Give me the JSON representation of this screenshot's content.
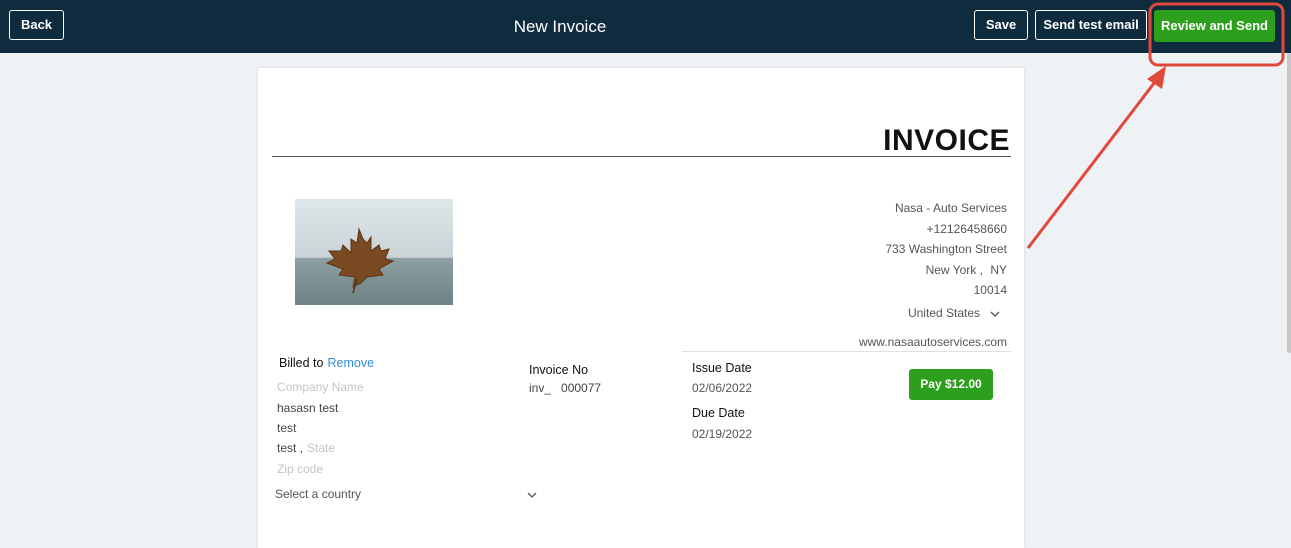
{
  "header": {
    "back_label": "Back",
    "title": "New Invoice",
    "save_label": "Save",
    "send_test_label": "Send test email",
    "review_send_label": "Review and Send"
  },
  "invoice": {
    "heading": "INVOICE",
    "company": {
      "name": "Nasa - Auto Services",
      "phone": "+12126458660",
      "street": "733 Washington Street",
      "city": "New York",
      "city_sep": ",",
      "state": "NY",
      "zip": "10014",
      "country": "United States",
      "website": "www.nasaautoservices.com"
    },
    "billed_to": {
      "label": "Billed to",
      "remove_label": "Remove",
      "company_placeholder": "Company Name",
      "name": "hasasn test",
      "line1": "test",
      "city": "test ,",
      "state_placeholder": "State",
      "zip_placeholder": "Zip code",
      "country_placeholder": "Select a country"
    },
    "invoice_no_label": "Invoice No",
    "invoice_no": "inv_   000077",
    "issue_date_label": "Issue Date",
    "issue_date": "02/06/2022",
    "due_date_label": "Due Date",
    "due_date": "02/19/2022",
    "pay_label": "Pay $12.00"
  },
  "colors": {
    "topbar": "#0f2c3f",
    "accent_green": "#2ca01c",
    "link_blue": "#2f8fd6",
    "annotation_red": "#e0483a"
  }
}
